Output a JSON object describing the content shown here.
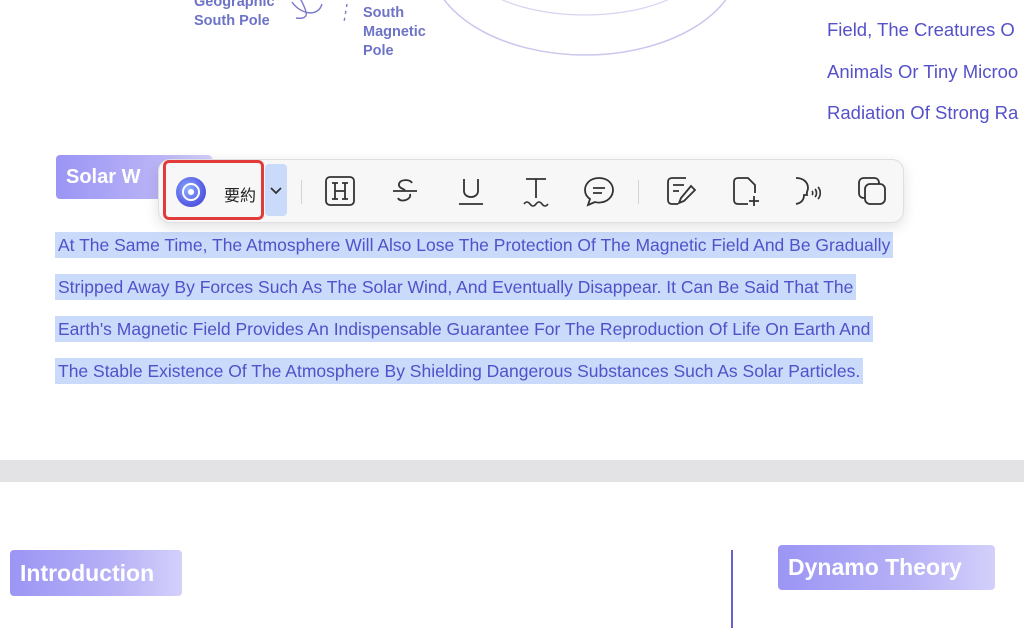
{
  "diagram": {
    "geographic_south_pole_label": "Geographic\nSouth Pole",
    "south_magnetic_pole_label": "South\nMagnetic\nPole"
  },
  "right_column": {
    "lines": [
      "Field, The Creatures O",
      "Animals Or Tiny Microo",
      "Radiation Of Strong Ra"
    ]
  },
  "section_heading": "Solar W",
  "toolbar": {
    "summary_label": "要約",
    "tools": [
      "heading-icon",
      "strikethrough-icon",
      "underline-icon",
      "squiggly-underline-icon",
      "comment-icon",
      "note-icon",
      "add-bookmark-icon",
      "read-aloud-icon",
      "copy-icon"
    ]
  },
  "paragraph": {
    "lines": [
      "At The Same Time, The Atmosphere Will Also Lose The Protection Of The Magnetic Field And Be Gradually",
      "Stripped Away By Forces Such As The Solar Wind, And Eventually Disappear. It Can Be Said That The",
      "Earth's Magnetic Field Provides An Indispensable Guarantee For The Reproduction Of Life On Earth And",
      "The Stable Existence Of The Atmosphere By Shielding Dangerous Substances Such As Solar Particles."
    ]
  },
  "next_page": {
    "intro_heading": "Introduction",
    "dynamo_heading": "Dynamo Theory"
  },
  "colors": {
    "selection": "#c9dafb",
    "text": "#4f52c8",
    "highlight_border": "#e23b3b"
  }
}
